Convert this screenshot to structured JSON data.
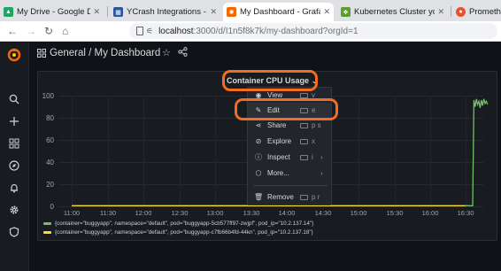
{
  "browser": {
    "tabs": [
      {
        "title": "My Drive - Google Drive",
        "active": false
      },
      {
        "title": "YCrash Integrations - Goo",
        "active": false
      },
      {
        "title": "My Dashboard - Grafana",
        "active": true
      },
      {
        "title": "Kubernetes Cluster ycras",
        "active": false
      },
      {
        "title": "Prometheu",
        "active": false
      }
    ],
    "url_host": "localhost",
    "url_path": ":3000/d/I1n5f8k7k/my-dashboard?orgId=1"
  },
  "header": {
    "breadcrumb": "General  /  My Dashboard"
  },
  "panel": {
    "title": "Container CPU Usage",
    "title_caret": "⌄"
  },
  "menu": {
    "items": [
      {
        "label": "View",
        "key": "v",
        "icon": "eye-icon"
      },
      {
        "label": "Edit",
        "key": "e",
        "icon": "edit-icon"
      },
      {
        "label": "Share",
        "key": "p s",
        "icon": "share-icon"
      },
      {
        "label": "Explore",
        "key": "x",
        "icon": "compass-icon"
      },
      {
        "label": "Inspect",
        "key": "i",
        "icon": "info-icon"
      },
      {
        "label": "More...",
        "key": "",
        "icon": "cube-icon"
      },
      {
        "label": "Remove",
        "key": "p r",
        "icon": "trash-icon"
      }
    ]
  },
  "chart_data": {
    "type": "line",
    "x_ticks": [
      "11:00",
      "11:30",
      "12:00",
      "12:30",
      "13:00",
      "13:30",
      "14:00",
      "14:30",
      "15:00",
      "15:30",
      "16:00",
      "16:30"
    ],
    "y_ticks": [
      "0",
      "20",
      "40",
      "60",
      "80",
      "100"
    ],
    "ylim": [
      0,
      100
    ],
    "grid": true,
    "legend_placement": "bottom-left",
    "series": [
      {
        "name": "{container=\"buggyapp\", namespace=\"default\", pod=\"buggyapp-5cb577ff97-zwjpf\", pod_ip=\"10.2.137.14\"}",
        "color": "#73bf69",
        "x": [
          "16:19",
          "16:22",
          "16:25",
          "16:26",
          "16:27",
          "16:28",
          "16:29",
          "16:30",
          "16:31",
          "16:32",
          "16:33",
          "16:34",
          "16:35",
          "16:36",
          "16:37"
        ],
        "values": [
          0,
          0,
          0,
          96,
          90,
          97,
          92,
          95,
          89,
          96,
          91,
          97,
          93,
          95,
          92
        ]
      },
      {
        "name": "{container=\"buggyapp\", namespace=\"default\", pod=\"buggyapp-c7fb66b4fd-44kn\", pod_ip=\"10.2.137.18\"}",
        "color": "#fade2a",
        "x": [
          "11:00",
          "16:22"
        ],
        "values": [
          0,
          0
        ]
      }
    ]
  },
  "colors": {
    "annotation": "#f26d21",
    "background": "#111217",
    "panel": "#181b1f"
  }
}
